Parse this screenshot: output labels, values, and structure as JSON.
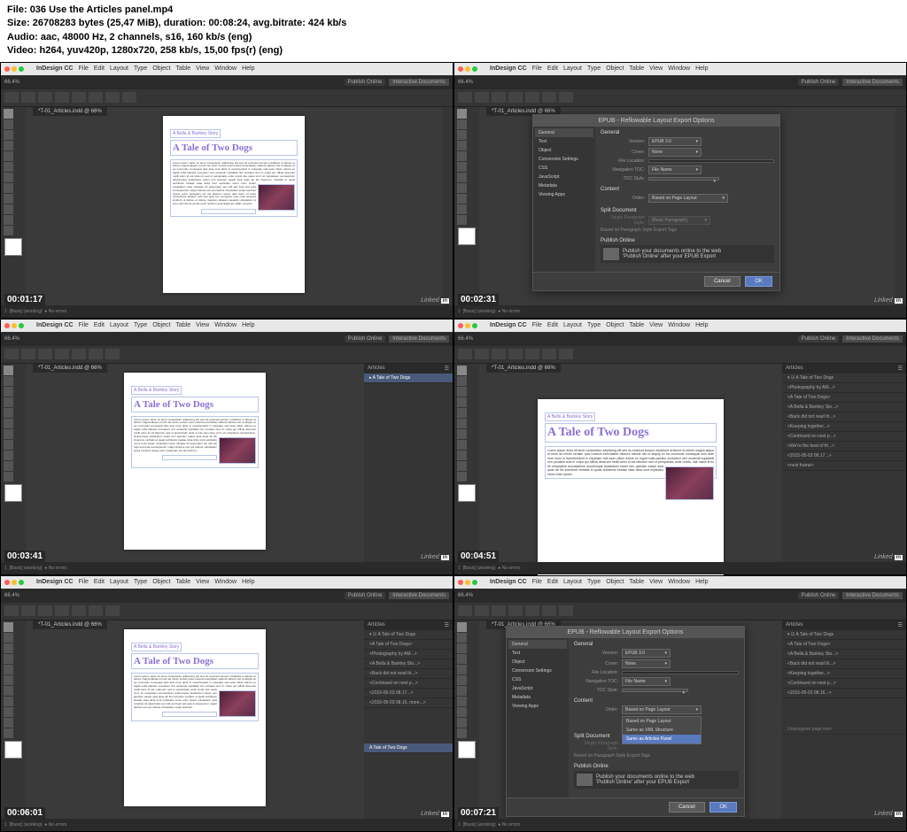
{
  "header": {
    "file_label": "File:",
    "file_name": "036 Use the Articles panel.mp4",
    "size_label": "Size:",
    "size_value": "26708283 bytes (25,47 MiB), duration: 00:08:24, avg.bitrate: 424 kb/s",
    "audio_label": "Audio:",
    "audio_value": "aac, 48000 Hz, 2 channels, s16, 160 kb/s (eng)",
    "video_label": "Video:",
    "video_value": "h264, yuv420p, 1280x720, 258 kb/s, 15,00 fps(r) (eng)"
  },
  "app_name": "InDesign CC",
  "menus": [
    "File",
    "Edit",
    "Layout",
    "Type",
    "Object",
    "Table",
    "View",
    "Window",
    "Help"
  ],
  "topbar": {
    "zoom": "66.4%",
    "publish": "Publish Online",
    "workspace": "Interactive Documents"
  },
  "doc_tab": "*T-01_Articles.indd @ 66%",
  "page": {
    "subtitle": "A Bella & Barkley Story",
    "title": "A Tale of Two Dogs"
  },
  "dialog": {
    "title": "EPUB - Reflowable Layout Export Options",
    "sidebar": [
      "General",
      "Text",
      "Object",
      "Conversion Settings",
      "CSS",
      "JavaScript",
      "Metadata",
      "Viewing Apps"
    ],
    "general": {
      "section": "General",
      "version_label": "Version:",
      "version_value": "EPUB 3.0",
      "cover_label": "Cover:",
      "cover_value": "None",
      "file_loc_label": "File Location:",
      "nav_label": "Navigation TOC:",
      "nav_value": "File Name",
      "toc_label": "TOC Style:"
    },
    "content": {
      "section": "Content",
      "order_label": "Order:",
      "order_value": "Based on Page Layout",
      "order_options": [
        "Based on Page Layout",
        "Same as XML Structure",
        "Same as Articles Panel"
      ]
    },
    "split": {
      "section": "Split Document",
      "para_label": "Single Paragraph Style:",
      "para_value": "[Basic Paragraph]",
      "tags_label": "Based on Paragraph Style Export Tags"
    },
    "publish": {
      "section": "Publish Online",
      "line1": "Publish your documents online to the web",
      "line2": "'Publish Online' after your EPUB Export"
    },
    "cancel": "Cancel",
    "ok": "OK"
  },
  "articles": {
    "panel_title": "Articles",
    "main": "A Tale of Two Dogs",
    "items": [
      "<Photography by AM...>",
      "<A Tale of Two Dogs>",
      "<A Bella & Barkley Sto...>",
      "<Back did not read th...>",
      "<Keeping together...>",
      "<Continued on next p...>",
      "<We're the best of fri...>",
      "<2015-05-03 08.17...>",
      "<next frame>"
    ],
    "items_t5": [
      "<A Tale of Two Dogs>",
      "<Photography by AM...>",
      "<A Bella & Barkley Sto...>",
      "<Back did not read th...>",
      "<Continued on next p...>",
      "<2015-05-03 08.17...>",
      "<2015-05-03 08.16, more...>"
    ],
    "items_t6": [
      "<A Tale of Two Dogs>",
      "<A Bella & Barkley Sto...>",
      "<Back did not read th...>",
      "<Keeping together...>",
      "<Continued on next p...>",
      "<2015-05-03 08.16...>"
    ],
    "bottom_item": "A Tale of Two Dogs",
    "unassigned": "Unassigned page item"
  },
  "timestamps": [
    "00:01:17",
    "00:02:31",
    "00:03:41",
    "00:04:51",
    "00:06:01",
    "00:07:21"
  ],
  "statusbar": {
    "page": "1",
    "basic": "[Basic] (working)",
    "errors": "No errors"
  },
  "linkedin": "Linked"
}
